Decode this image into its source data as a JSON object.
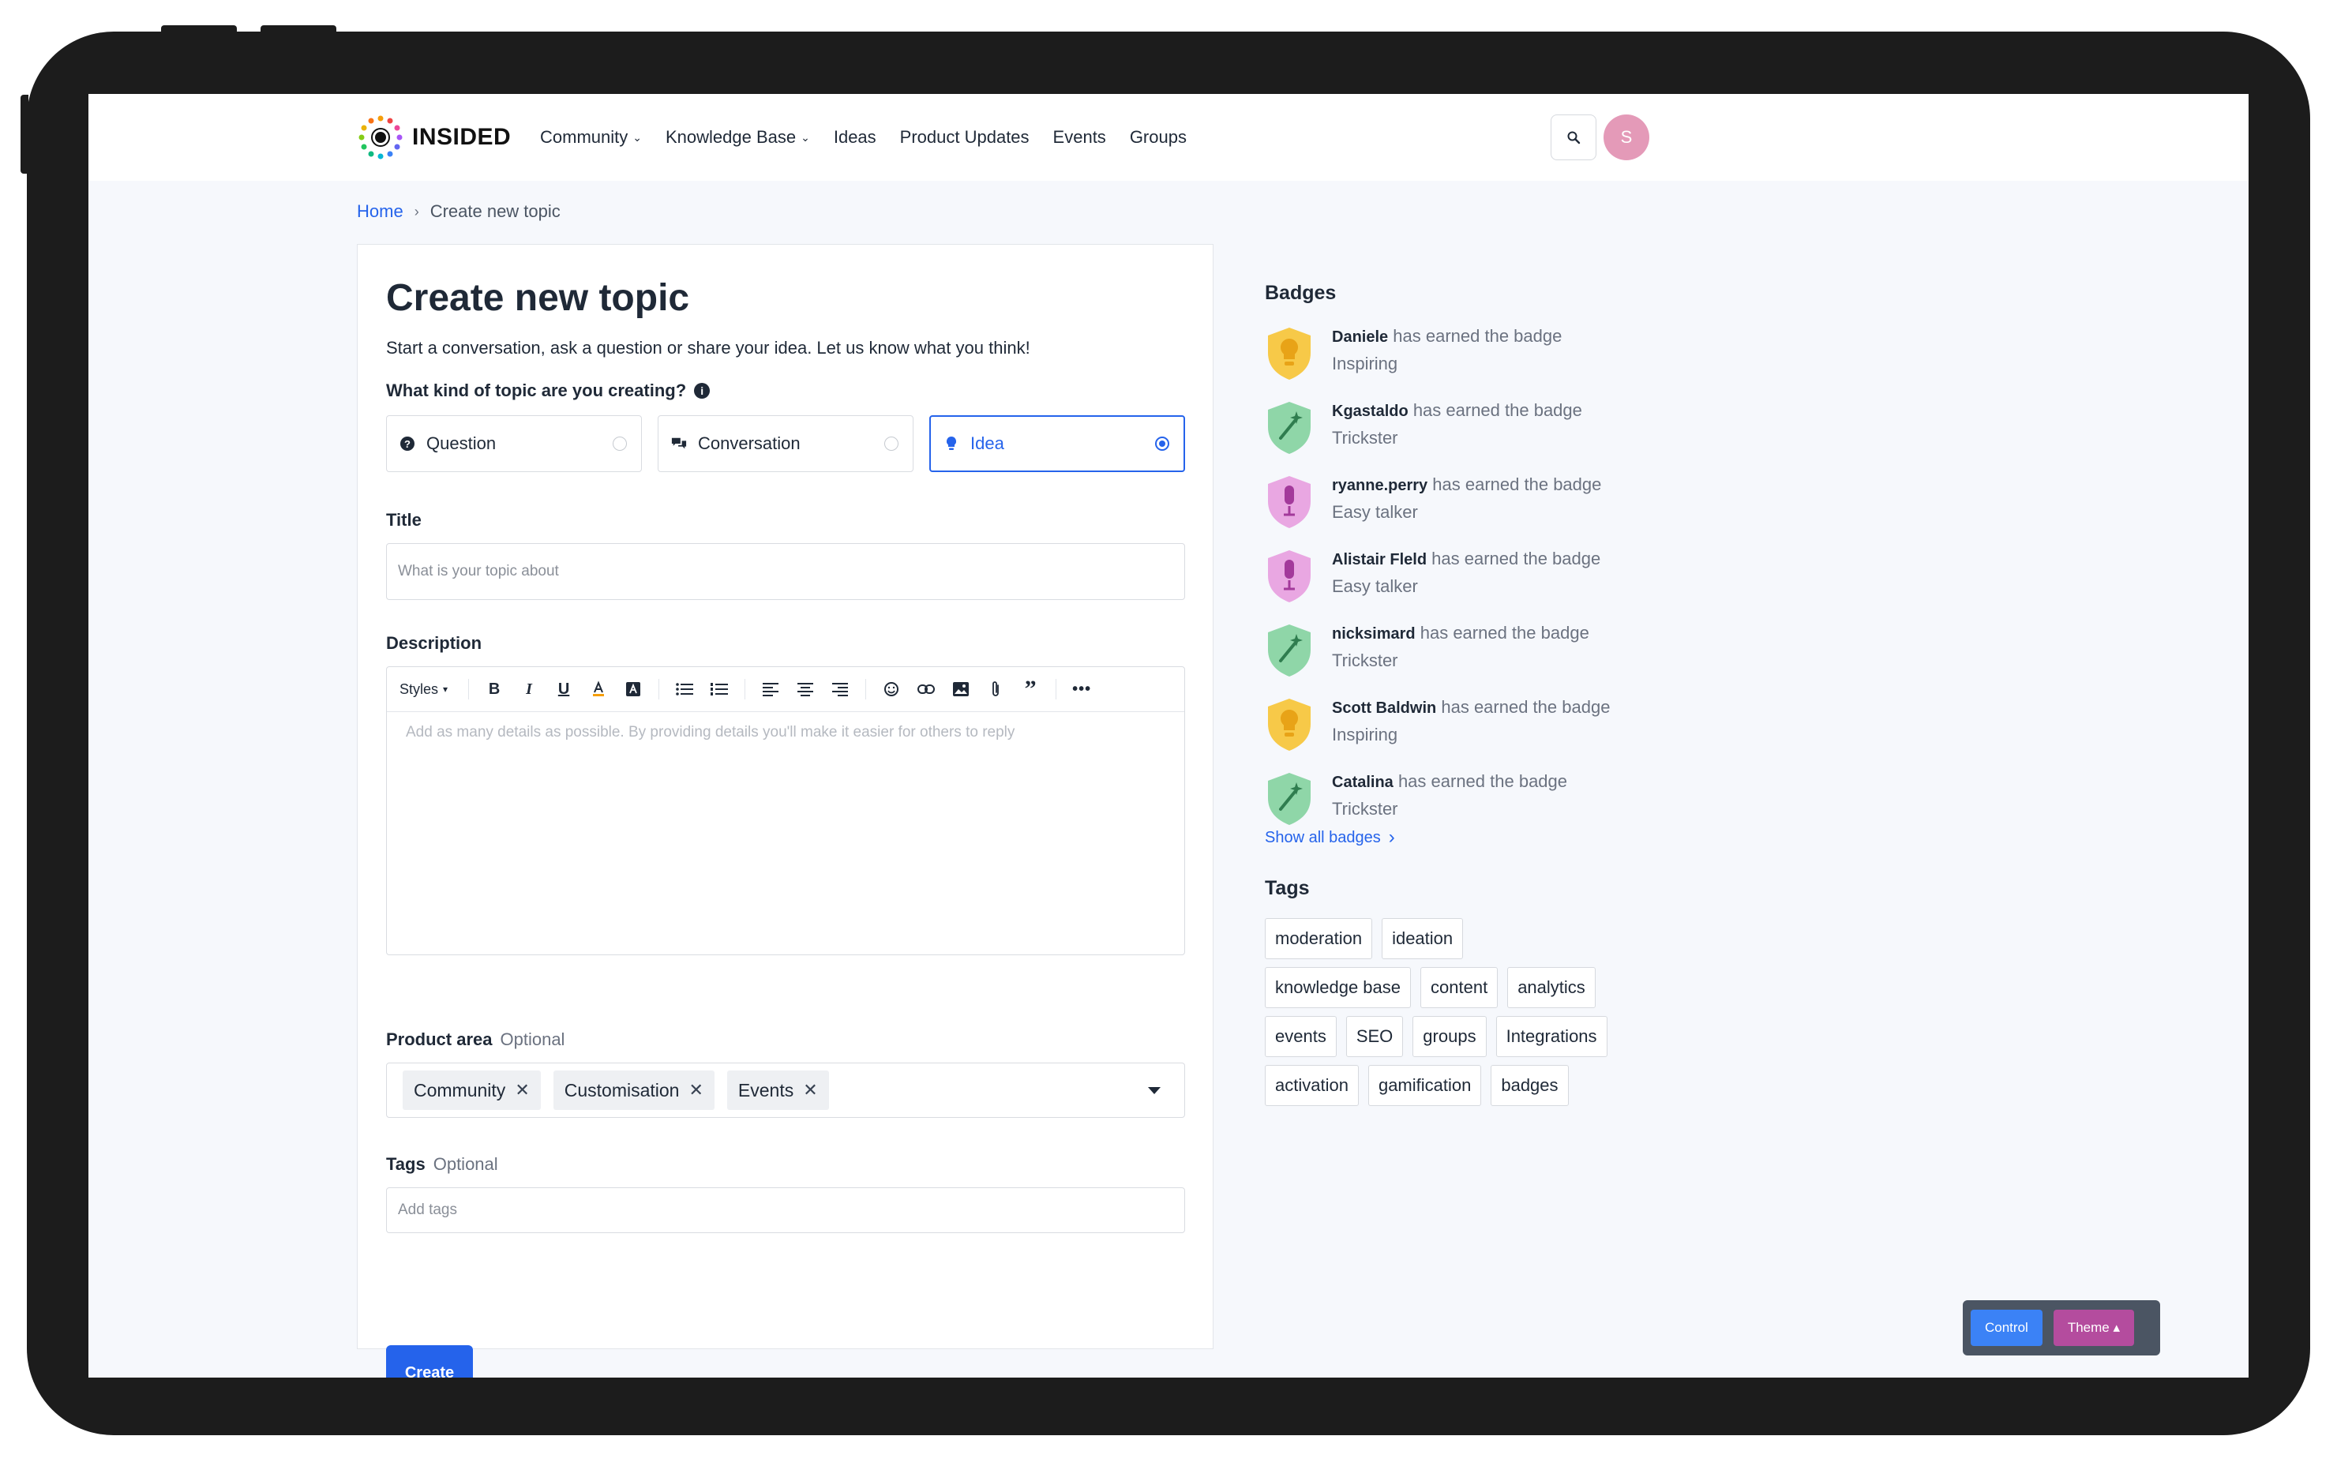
{
  "nav": {
    "logo_text": "INSIDED",
    "items": [
      {
        "label": "Community",
        "dropdown": true
      },
      {
        "label": "Knowledge Base",
        "dropdown": true
      },
      {
        "label": "Ideas",
        "dropdown": false
      },
      {
        "label": "Product Updates",
        "dropdown": false
      },
      {
        "label": "Events",
        "dropdown": false
      },
      {
        "label": "Groups",
        "dropdown": false
      }
    ],
    "avatar_initial": "S"
  },
  "breadcrumb": {
    "home": "Home",
    "current": "Create new topic"
  },
  "form": {
    "heading": "Create new topic",
    "subtitle": "Start a conversation, ask a question or share your idea. Let us know what you think!",
    "type_label": "What kind of topic are you creating?",
    "types": [
      {
        "label": "Question",
        "selected": false
      },
      {
        "label": "Conversation",
        "selected": false
      },
      {
        "label": "Idea",
        "selected": true
      }
    ],
    "title_label": "Title",
    "title_placeholder": "What is your topic about",
    "description_label": "Description",
    "styles_label": "Styles",
    "description_placeholder": "Add as many details as possible. By providing details you'll make it easier for others to reply",
    "product_area_label": "Product area",
    "optional": "Optional",
    "product_areas": [
      "Community",
      "Customisation",
      "Events"
    ],
    "tags_label": "Tags",
    "tags_placeholder": "Add tags",
    "create_label": "Create"
  },
  "badges": {
    "title": "Badges",
    "earned_text": "has earned the badge",
    "items": [
      {
        "user": "Daniele",
        "badge": "Inspiring",
        "icon": "lightbulb-badge-icon",
        "color": "#f7c948"
      },
      {
        "user": "Kgastaldo",
        "badge": "Trickster",
        "icon": "magic-wand-badge-icon",
        "color": "#8fd6a8"
      },
      {
        "user": "ryanne.perry",
        "badge": "Easy talker",
        "icon": "microphone-badge-icon",
        "color": "#e9a7e2"
      },
      {
        "user": "Alistair Fleld",
        "badge": "Easy talker",
        "icon": "microphone-badge-icon",
        "color": "#e9a7e2"
      },
      {
        "user": "nicksimard",
        "badge": "Trickster",
        "icon": "magic-wand-badge-icon",
        "color": "#8fd6a8"
      },
      {
        "user": "Scott Baldwin",
        "badge": "Inspiring",
        "icon": "lightbulb-badge-icon",
        "color": "#f7c948"
      },
      {
        "user": "Catalina",
        "badge": "Trickster",
        "icon": "magic-wand-badge-icon",
        "color": "#8fd6a8"
      }
    ],
    "show_all": "Show all badges"
  },
  "tags": {
    "title": "Tags",
    "rows": [
      [
        "moderation",
        "ideation"
      ],
      [
        "knowledge base",
        "content",
        "analytics"
      ],
      [
        "events",
        "SEO",
        "groups",
        "Integrations"
      ],
      [
        "activation",
        "gamification",
        "badges"
      ]
    ]
  },
  "controls": {
    "control": "Control",
    "theme": "Theme ▴"
  },
  "colors": {
    "accent": "#2563eb",
    "control": "#3b82f6",
    "theme": "#b44c9e",
    "avatar": "#e49ab8"
  }
}
